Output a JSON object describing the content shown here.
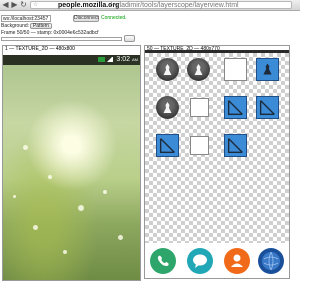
{
  "browser": {
    "url_host": "people.mozilla.org",
    "url_path": "/~vladimir/tools/layerscope/layerview.html",
    "back_icon": "back-arrow-icon",
    "forward_icon": "forward-arrow-icon",
    "reload_icon": "reload-icon",
    "star_icon": "star-icon"
  },
  "controls": {
    "ws_address": "ws://localhost:23457",
    "disconnect_label": "Disconnect",
    "status": "Connected.",
    "background_label": "Background:",
    "background_option": "Pattern",
    "frame_info": "Frame 50/50 — stamp: 0x0004e6c532adbcf"
  },
  "left_panel": {
    "title": "1 — TEXTURE_2D — 480x800",
    "clock": "3:02",
    "clock_suffix": "AM"
  },
  "right_panel": {
    "title": "50 — TEXTURE_2D — 480x770"
  },
  "colors": {
    "status_green": "#00a000",
    "app_blue": "#3c8bd6",
    "phone_green": "#2ea66b",
    "msg_teal": "#22a7b6",
    "contacts_orange": "#f06a1a",
    "browser_blue": "#1a4f9a"
  },
  "dock_apps": [
    "phone-icon",
    "messages-icon",
    "contacts-icon",
    "browser-icon"
  ]
}
